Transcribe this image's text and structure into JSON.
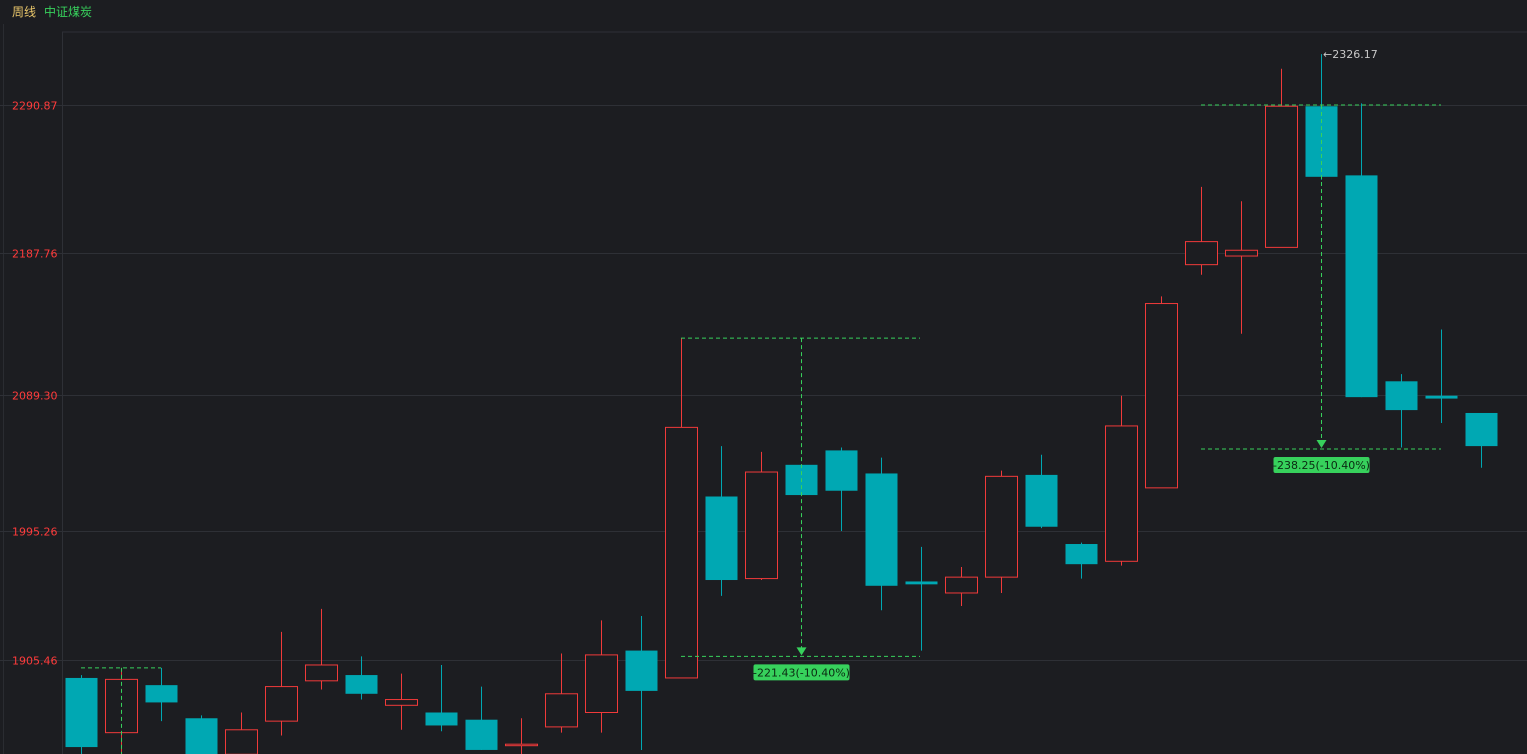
{
  "header": {
    "period": "周线",
    "symbol": "中证煤炭"
  },
  "colors": {
    "up": "#f03a3a",
    "down": "#00a8b3",
    "measure": "#37d15c",
    "grid": "#2e3036"
  },
  "chart_data": {
    "type": "candlestick",
    "y_ticks": [
      "2290.87",
      "2187.76",
      "2089.30",
      "1995.26",
      "1905.46"
    ],
    "y_tick_values": [
      2290.87,
      2187.76,
      2089.3,
      1995.26,
      1905.46
    ],
    "ylim": [
      1840.0,
      2366.0
    ],
    "grid": true,
    "peak_label": "←2326.17",
    "peak_value": 2326.17,
    "candles": [
      {
        "open": 1893.0,
        "high": 1895.0,
        "low": 1835.0,
        "close": 1845.0
      },
      {
        "open": 1855.0,
        "high": 1900.0,
        "low": 1835.0,
        "close": 1892.0
      },
      {
        "open": 1888.0,
        "high": 1900.0,
        "low": 1863.0,
        "close": 1876.0
      },
      {
        "open": 1865.0,
        "high": 1867.0,
        "low": 1836.0,
        "close": 1840.0
      },
      {
        "open": 1840.0,
        "high": 1869.0,
        "low": 1836.0,
        "close": 1857.0
      },
      {
        "open": 1863.0,
        "high": 1925.0,
        "low": 1853.0,
        "close": 1887.0
      },
      {
        "open": 1891.0,
        "high": 1941.0,
        "low": 1885.0,
        "close": 1902.0
      },
      {
        "open": 1895.0,
        "high": 1908.0,
        "low": 1878.0,
        "close": 1882.0
      },
      {
        "open": 1874.0,
        "high": 1896.0,
        "low": 1857.0,
        "close": 1878.0
      },
      {
        "open": 1869.0,
        "high": 1902.0,
        "low": 1856.0,
        "close": 1860.0
      },
      {
        "open": 1864.0,
        "high": 1887.0,
        "low": 1843.0,
        "close": 1843.0
      },
      {
        "open": 1847.0,
        "high": 1865.0,
        "low": 1836.0,
        "close": 1847.0
      },
      {
        "open": 1859.0,
        "high": 1910.0,
        "low": 1855.0,
        "close": 1882.0
      },
      {
        "open": 1869.0,
        "high": 1933.0,
        "low": 1855.0,
        "close": 1909.0
      },
      {
        "open": 1912.0,
        "high": 1936.0,
        "low": 1843.0,
        "close": 1884.0
      },
      {
        "open": 1893.0,
        "high": 2129.0,
        "low": 1893.0,
        "close": 2067.0
      },
      {
        "open": 2019.0,
        "high": 2054.0,
        "low": 1950.0,
        "close": 1961.0
      },
      {
        "open": 1962.0,
        "high": 2050.0,
        "low": 1961.0,
        "close": 2036.0
      },
      {
        "open": 2041.0,
        "high": 2041.0,
        "low": 2020.0,
        "close": 2020.0
      },
      {
        "open": 2051.0,
        "high": 2053.0,
        "low": 1995.0,
        "close": 2023.0
      },
      {
        "open": 2035.0,
        "high": 2046.0,
        "low": 1940.0,
        "close": 1957.0
      },
      {
        "open": 1960.0,
        "high": 1984.0,
        "low": 1912.0,
        "close": 1958.0
      },
      {
        "open": 1952.0,
        "high": 1970.0,
        "low": 1943.0,
        "close": 1963.0
      },
      {
        "open": 1963.0,
        "high": 2037.0,
        "low": 1952.0,
        "close": 2033.0
      },
      {
        "open": 2034.0,
        "high": 2048.0,
        "low": 1997.0,
        "close": 1998.0
      },
      {
        "open": 1986.0,
        "high": 1987.0,
        "low": 1962.0,
        "close": 1972.0
      },
      {
        "open": 1974.0,
        "high": 2089.0,
        "low": 1971.0,
        "close": 2068.0
      },
      {
        "open": 2025.0,
        "high": 2158.0,
        "low": 2025.0,
        "close": 2153.0
      },
      {
        "open": 2180.0,
        "high": 2234.0,
        "low": 2173.0,
        "close": 2196.0
      },
      {
        "open": 2186.0,
        "high": 2224.0,
        "low": 2132.0,
        "close": 2190.0
      },
      {
        "open": 2192.0,
        "high": 2316.0,
        "low": 2192.0,
        "close": 2290.0
      },
      {
        "open": 2290.0,
        "high": 2326.17,
        "low": 2239.0,
        "close": 2241.0
      },
      {
        "open": 2242.0,
        "high": 2292.0,
        "low": 2088.0,
        "close": 2088.0
      },
      {
        "open": 2099.0,
        "high": 2104.0,
        "low": 2053.0,
        "close": 2079.0
      },
      {
        "open": 2089.0,
        "high": 2135.0,
        "low": 2070.0,
        "close": 2087.0
      },
      {
        "open": 2077.0,
        "high": 2077.0,
        "low": 2039.0,
        "close": 2054.0
      }
    ],
    "measurements": [
      {
        "label": "-221.43(-10.40%)",
        "from_index": 15,
        "to_index": 21,
        "high_value": 2129.0,
        "low_value": 1908.0
      },
      {
        "label": "-238.25(-10.40%)",
        "from_index": 29,
        "to_index": 34,
        "high_value": 2290.87,
        "low_value": 2052.0
      },
      {
        "label": "",
        "from_index": 0,
        "to_index": 2,
        "high_value": 1900.0,
        "low_value": 1836.0
      }
    ]
  }
}
